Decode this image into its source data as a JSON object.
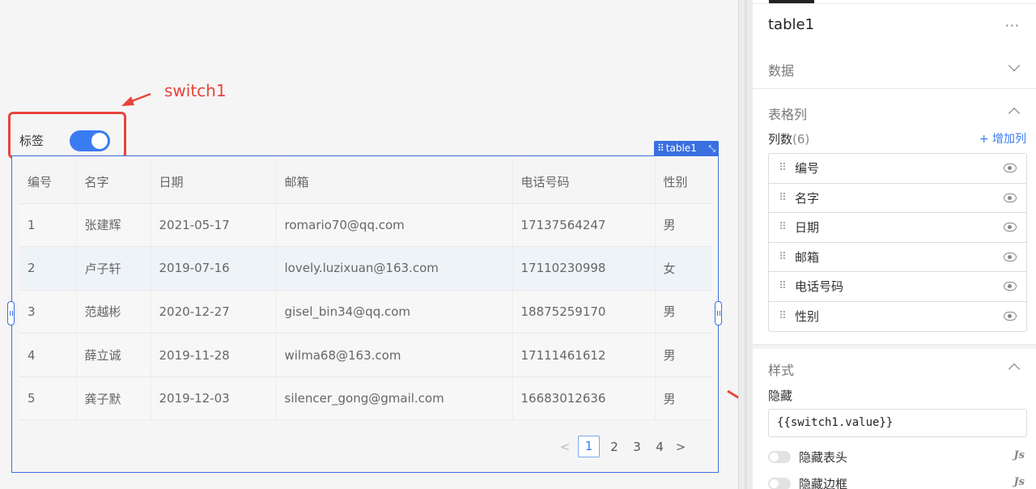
{
  "annotation": {
    "label": "switch1"
  },
  "switch": {
    "label": "标签",
    "checked": true
  },
  "table": {
    "tag_label": "table1",
    "columns": [
      "编号",
      "名字",
      "日期",
      "邮箱",
      "电话号码",
      "性别"
    ],
    "rows": [
      [
        "1",
        "张建辉",
        "2021-05-17",
        "romario70@qq.com",
        "17137564247",
        "男"
      ],
      [
        "2",
        "卢子轩",
        "2019-07-16",
        "lovely.luzixuan@163.com",
        "17110230998",
        "女"
      ],
      [
        "3",
        "范越彬",
        "2020-12-27",
        "gisel_bin34@qq.com",
        "18875259170",
        "男"
      ],
      [
        "4",
        "薛立诚",
        "2019-11-28",
        "wilma68@163.com",
        "17111461612",
        "男"
      ],
      [
        "5",
        "龚子默",
        "2019-12-03",
        "silencer_gong@gmail.com",
        "16683012636",
        "男"
      ]
    ],
    "highlighted_row": 1,
    "pagination": {
      "pages": [
        "1",
        "2",
        "3",
        "4"
      ],
      "current": "1",
      "prev": "<",
      "next": ">"
    }
  },
  "panel": {
    "component_name": "table1",
    "more": "···",
    "sections": {
      "data": "数据",
      "columns": "表格列",
      "style": "样式"
    },
    "column_count_label": "列数",
    "column_count": "(6)",
    "add_column": "+ 增加列",
    "column_items": [
      "编号",
      "名字",
      "日期",
      "邮箱",
      "电话号码",
      "性别"
    ],
    "hide_label": "隐藏",
    "hide_value": "{{switch1.value}}",
    "toggles": [
      {
        "label": "隐藏表头",
        "js": "Js"
      },
      {
        "label": "隐藏边框",
        "js": "Js"
      }
    ]
  },
  "colors": {
    "accent": "#3a7bf2",
    "frame": "#3a6fe0",
    "annotation": "#e8443a"
  }
}
